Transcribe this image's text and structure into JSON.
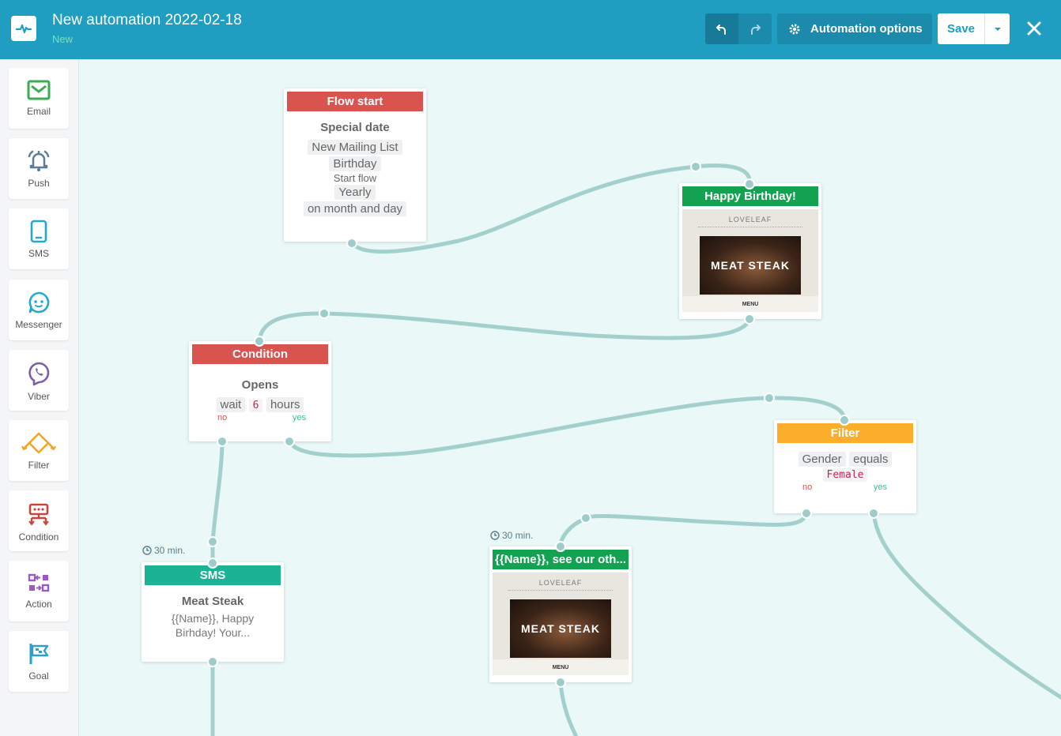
{
  "header": {
    "title": "New automation 2022-02-18",
    "status": "New",
    "options_label": "Automation options",
    "save_label": "Save"
  },
  "sidebar": {
    "items": [
      {
        "label": "Email",
        "icon": "email-icon"
      },
      {
        "label": "Push",
        "icon": "bell-icon"
      },
      {
        "label": "SMS",
        "icon": "phone-icon"
      },
      {
        "label": "Messenger",
        "icon": "messenger-icon"
      },
      {
        "label": "Viber",
        "icon": "viber-icon"
      },
      {
        "label": "Filter",
        "icon": "filter-icon"
      },
      {
        "label": "Condition",
        "icon": "condition-icon"
      },
      {
        "label": "Action",
        "icon": "action-icon"
      },
      {
        "label": "Goal",
        "icon": "goal-icon"
      }
    ]
  },
  "nodes": {
    "flow_start": {
      "header": "Flow start",
      "title": "Special date",
      "list": "New Mailing List",
      "field": "Birthday",
      "start_label": "Start flow",
      "frequency": "Yearly",
      "match": "on month and day"
    },
    "birthday_email": {
      "header": "Happy Birthday!",
      "brand": "LOVELEAF",
      "hero": "MEAT STEAK",
      "footer": "MENU"
    },
    "condition": {
      "header": "Condition",
      "title": "Opens",
      "wait_label": "wait",
      "wait_value": "6",
      "wait_unit": "hours",
      "no": "no",
      "yes": "yes"
    },
    "filter": {
      "header": "Filter",
      "field": "Gender",
      "operator": "equals",
      "value": "Female",
      "no": "no",
      "yes": "yes"
    },
    "sms": {
      "delay": "30 min.",
      "header": "SMS",
      "title": "Meat Steak",
      "text": "{{Name}}, Happy Birhday! Your..."
    },
    "email2": {
      "delay": "30 min.",
      "header": "{{Name}}, see our oth...",
      "brand": "LOVELEAF",
      "hero": "MEAT STEAK",
      "footer": "MENU"
    }
  },
  "colors": {
    "header_bg": "#1f9ec2",
    "canvas_bg": "#eaf8f8",
    "wire": "#9ccdcb",
    "flow_start": "#d9534f",
    "email": "#12a252",
    "sms": "#1ab394",
    "filter": "#fbae2c"
  }
}
